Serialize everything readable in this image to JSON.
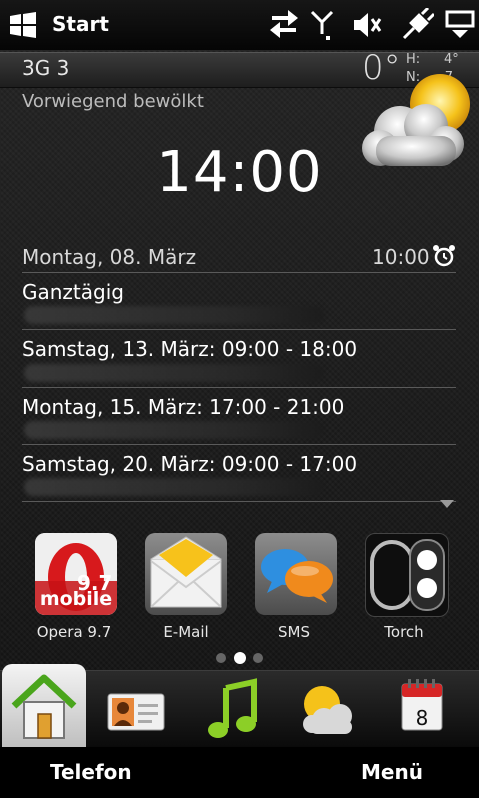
{
  "status_bar": {
    "title": "Start",
    "icons": [
      "windows-logo-icon",
      "data-transfer-icon",
      "signal-icon",
      "speaker-muted-icon",
      "usb-plug-icon",
      "connection-screen-icon"
    ]
  },
  "network": {
    "label": "3G 3"
  },
  "weather": {
    "temperature": "0°",
    "high_label": "H:",
    "high_value": "4°",
    "low_label": "N:",
    "low_value": "-7",
    "description": "Vorwiegend bewölkt",
    "icon": "partly-cloudy-icon"
  },
  "clock": {
    "time": "14:00"
  },
  "calendar": {
    "date": "Montag, 08. März",
    "alarm_time": "10:00",
    "events": [
      {
        "title": "Ganztägig"
      },
      {
        "title": "Samstag, 13. März: 09:00 - 18:00"
      },
      {
        "title": "Montag, 15. März: 17:00 - 21:00"
      },
      {
        "title": "Samstag, 20. März: 09:00 - 17:00"
      }
    ]
  },
  "apps": [
    {
      "label": "Opera 9.7",
      "icon": "opera-mobile-icon",
      "badge_top": "9.7",
      "badge_bottom": "mobile"
    },
    {
      "label": "E-Mail",
      "icon": "email-envelope-icon"
    },
    {
      "label": "SMS",
      "icon": "sms-bubbles-icon"
    },
    {
      "label": "Torch",
      "icon": "torch-icon"
    }
  ],
  "pager": {
    "pages": 3,
    "active": 2
  },
  "tabs": [
    {
      "name": "home",
      "icon": "home-icon",
      "active": true
    },
    {
      "name": "contacts",
      "icon": "contact-card-icon"
    },
    {
      "name": "music",
      "icon": "music-note-icon"
    },
    {
      "name": "weather",
      "icon": "weather-icon"
    },
    {
      "name": "calendar",
      "icon": "calendar-icon",
      "day": "8"
    }
  ],
  "softkeys": {
    "left": "Telefon",
    "right": "Menü"
  },
  "colors": {
    "opera_red": "#d7191c",
    "email_yellow": "#f7c21b",
    "sms_blue": "#2e8fe0",
    "sms_orange": "#f08a1c",
    "music_green": "#8ccf27",
    "calendar_red": "#d62626"
  }
}
